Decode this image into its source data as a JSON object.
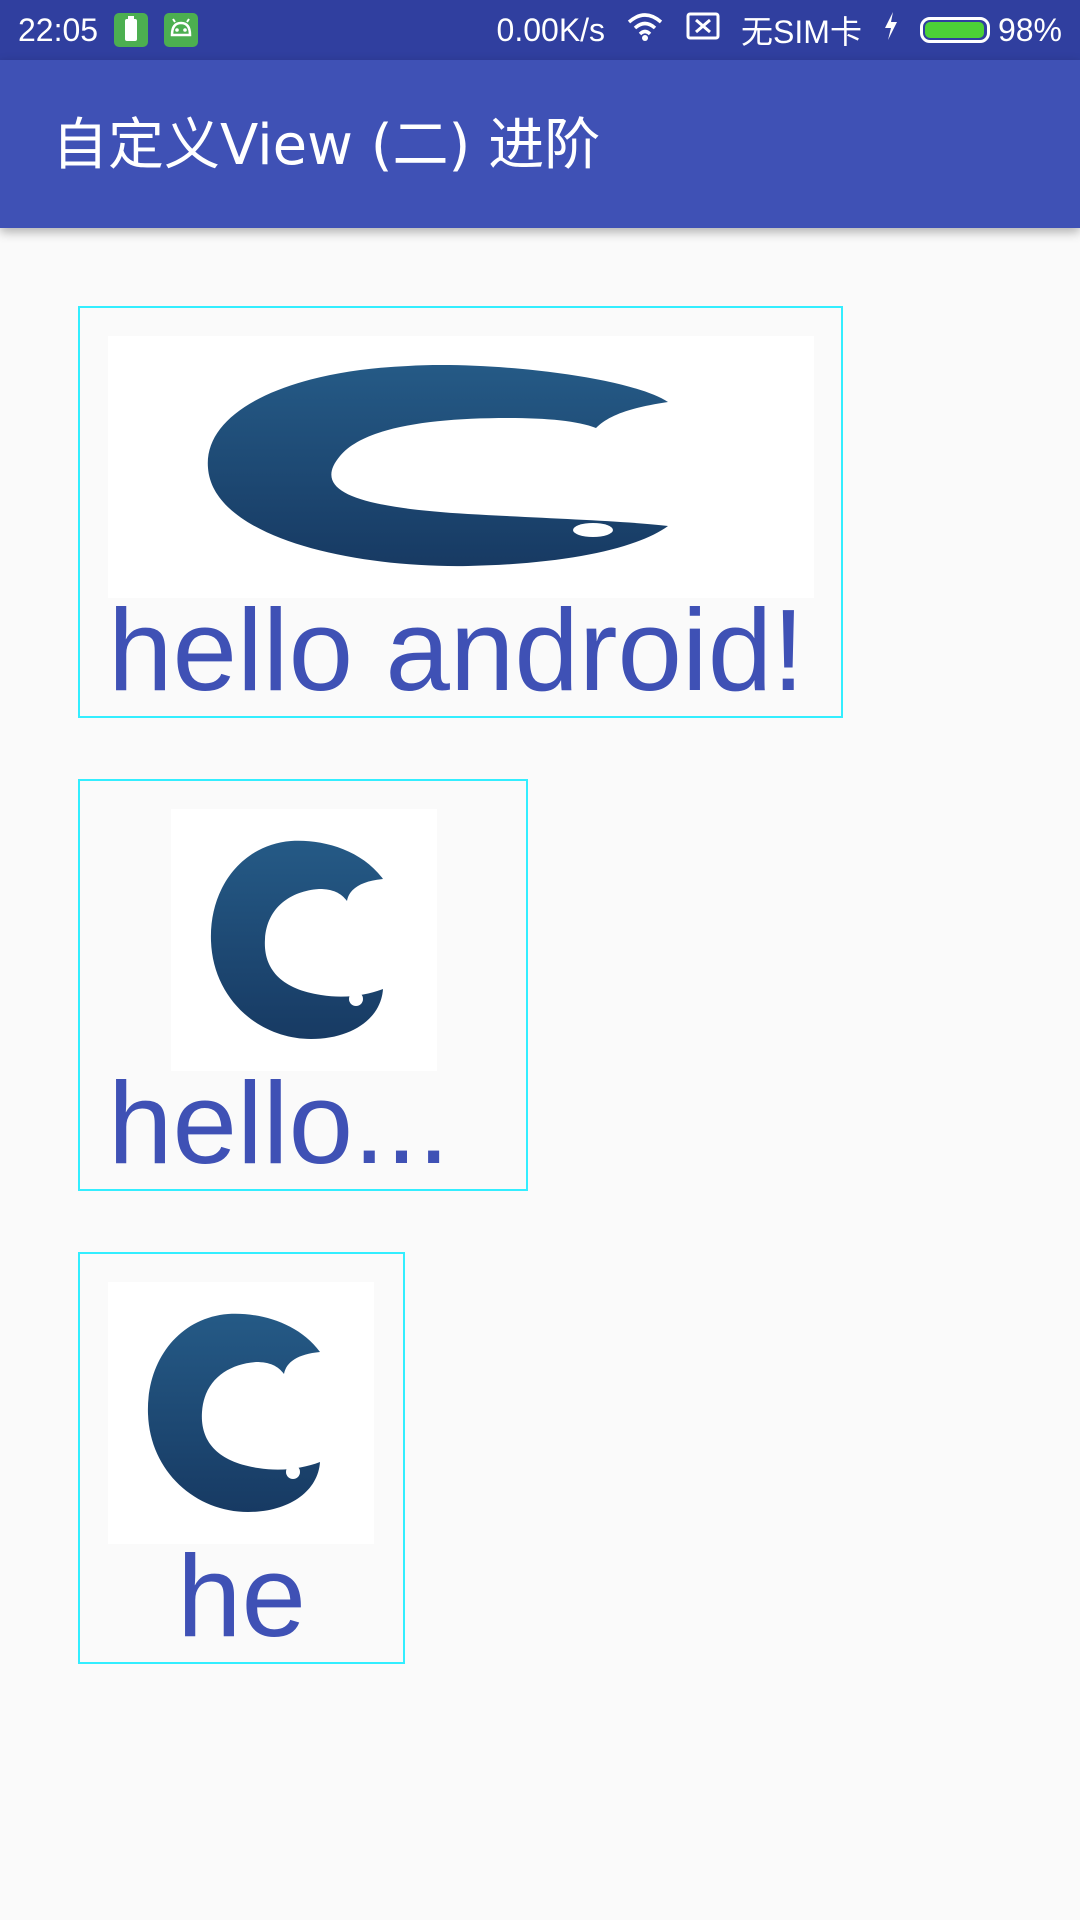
{
  "status_bar": {
    "time": "22:05",
    "network_speed": "0.00K/s",
    "sim_status": "无SIM卡",
    "battery_percent": "98%",
    "battery_level": 0.98,
    "icons": [
      "battery-notification-icon",
      "android-notification-icon",
      "wifi-icon",
      "no-sim-icon",
      "charging-icon",
      "battery-icon"
    ]
  },
  "app_bar": {
    "title": "自定义View (二) 进阶"
  },
  "colors": {
    "status_bar": "#303f9f",
    "app_bar": "#3f51b5",
    "text_accent": "#3f51b5",
    "card_border": "#33eeff",
    "logo": "#1f4e79",
    "background": "#fafafa"
  },
  "cards": [
    {
      "label": "hello android!",
      "image": "logo-image-wide"
    },
    {
      "label": "hello...",
      "image": "logo-image"
    },
    {
      "label": "he",
      "image": "logo-image"
    }
  ]
}
